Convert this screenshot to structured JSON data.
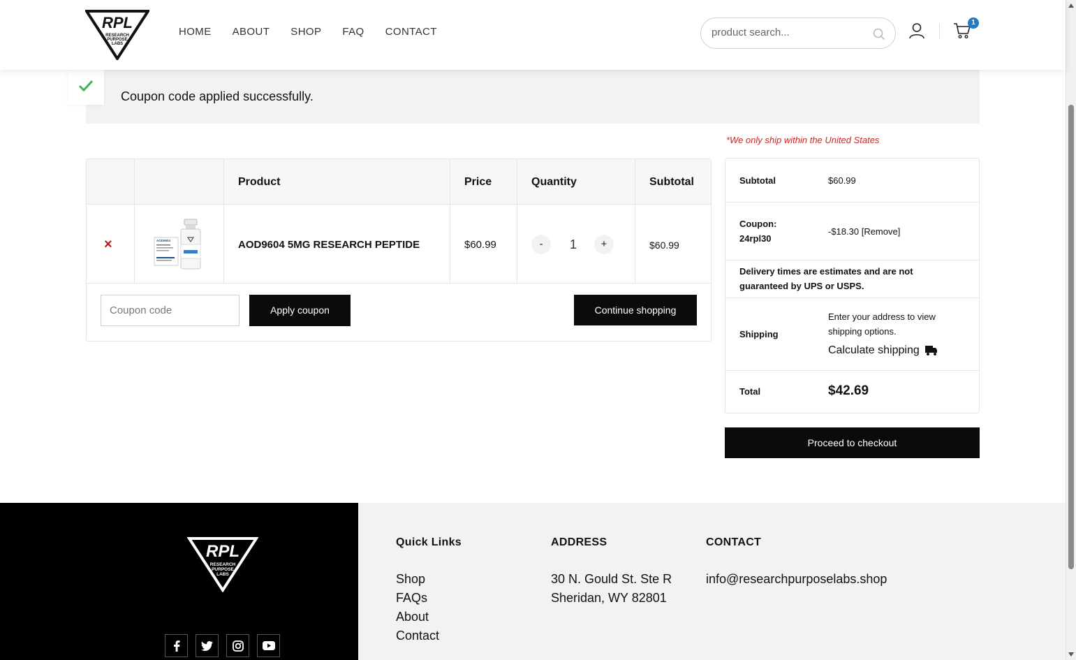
{
  "header": {
    "logo_text": "RPL",
    "logo_subtext": "RESEARCH PURPOSE LABS",
    "nav": [
      "HOME",
      "ABOUT",
      "SHOP",
      "FAQ",
      "CONTACT"
    ],
    "search_placeholder": "product search...",
    "cart_count": "1"
  },
  "notice": {
    "message": "Coupon code applied successfully."
  },
  "cart": {
    "headers": {
      "product": "Product",
      "price": "Price",
      "quantity": "Quantity",
      "subtotal": "Subtotal"
    },
    "items": [
      {
        "remove": "×",
        "name": "AOD9604 5MG RESEARCH PEPTIDE",
        "price": "$60.99",
        "qty_minus": "-",
        "qty": "1",
        "qty_plus": "+",
        "subtotal": "$60.99",
        "label_text": "AOD9604"
      }
    ],
    "coupon_placeholder": "Coupon code",
    "apply_label": "Apply coupon",
    "continue_label": "Continue shopping"
  },
  "totals": {
    "ship_note": "*We only ship within the United States",
    "subtotal_label": "Subtotal",
    "subtotal_value": "$60.99",
    "coupon_label_line1": "Coupon:",
    "coupon_label_line2": "24rpl30",
    "coupon_value": "-$18.30 [Remove]",
    "delivery_note_line1": "Delivery times are estimates and are not",
    "delivery_note_line2": "guaranteed by UPS or USPS.",
    "shipping_label": "Shipping",
    "shipping_text_line1": "Enter your address to view",
    "shipping_text_line2": "shipping options.",
    "calc_shipping": "Calculate shipping",
    "total_label": "Total",
    "total_value": "$42.69",
    "checkout_label": "Proceed to checkout"
  },
  "footer": {
    "quick_links_title": "Quick Links",
    "quick_links": [
      "Shop",
      "FAQs",
      "About",
      "Contact"
    ],
    "address_title": "ADDRESS",
    "address_line1": "30 N. Gould St. Ste R",
    "address_line2": "Sheridan, WY 82801",
    "contact_title": "CONTACT",
    "contact_email": "info@researchpurposelabs.shop",
    "social_icons": [
      "facebook-icon",
      "twitter-icon",
      "instagram-icon",
      "youtube-icon"
    ]
  },
  "colors": {
    "accent": "#0b0b0b",
    "badge": "#1f7ac9",
    "success": "#3cb55a",
    "danger": "#c62828"
  }
}
